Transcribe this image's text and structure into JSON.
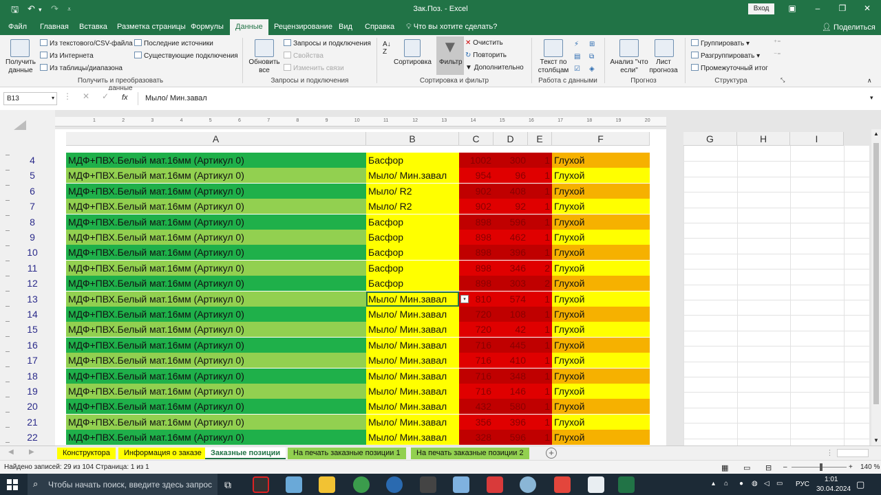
{
  "titlebar": {
    "title": "Зак.Поз. - Excel",
    "signin_label": "Вход",
    "save_icon": "save-icon",
    "undo_icon": "undo-icon",
    "redo_icon": "redo-icon",
    "customize_icon": "customize-icon"
  },
  "tabs": {
    "items": [
      "Файл",
      "Главная",
      "Вставка",
      "Разметка страницы",
      "Формулы",
      "Данные",
      "Рецензирование",
      "Вид",
      "Справка"
    ],
    "active": "Данные",
    "tellme": "Что вы хотите сделать?",
    "share": "Поделиться"
  },
  "ribbon": {
    "get_data": "Получить данные",
    "from_text": "Из текстового/CSV-файла",
    "from_web": "Из Интернета",
    "from_table": "Из таблицы/диапазона",
    "recent_sources": "Последние источники",
    "existing_connections": "Существующие подключения",
    "group_get": "Получить и преобразовать данные",
    "refresh_all": "Обновить все",
    "queries_connections": "Запросы и подключения",
    "properties": "Свойства",
    "edit_links": "Изменить связи",
    "group_queries": "Запросы и подключения",
    "sort_az_icon": "sort-az-icon",
    "sort": "Сортировка",
    "filter": "Фильтр",
    "clear": "Очистить",
    "reapply": "Повторить",
    "advanced": "Дополнительно",
    "group_sort": "Сортировка и фильтр",
    "text_to_columns": "Текст по столбцам",
    "group_data_tools": "Работа с данными",
    "what_if": "Анализ \"что если\"",
    "forecast_sheet": "Лист прогноза",
    "group_forecast": "Прогноз",
    "group": "Группировать",
    "ungroup": "Разгруппировать",
    "subtotal": "Промежуточный итог",
    "group_outline": "Структура"
  },
  "formula_bar": {
    "name_box": "B13",
    "fx": "fx",
    "formula": "Мыло/ Мин.завал"
  },
  "columns": [
    "A",
    "B",
    "C",
    "D",
    "E",
    "F",
    "G",
    "H",
    "I"
  ],
  "ruler_ticks": [
    "1",
    "2",
    "3",
    "4",
    "5",
    "6",
    "7",
    "8",
    "9",
    "10",
    "11",
    "12",
    "13",
    "14",
    "15",
    "16",
    "17",
    "18",
    "19",
    "20"
  ],
  "rows": [
    {
      "num": "4",
      "a": "МДФ+ПВХ.Белый мат.16мм (Артикул 0)",
      "b": "Басфор",
      "c": "1002",
      "d": "300",
      "e": "1",
      "f": "Глухой"
    },
    {
      "num": "5",
      "a": "МДФ+ПВХ.Белый мат.16мм (Артикул 0)",
      "b": "Мыло/ Мин.завал",
      "c": "954",
      "d": "96",
      "e": "1",
      "f": "Глухой"
    },
    {
      "num": "6",
      "a": "МДФ+ПВХ.Белый мат.16мм (Артикул 0)",
      "b": "Мыло/ R2",
      "c": "902",
      "d": "408",
      "e": "1",
      "f": "Глухой"
    },
    {
      "num": "7",
      "a": "МДФ+ПВХ.Белый мат.16мм (Артикул 0)",
      "b": "Мыло/ R2",
      "c": "902",
      "d": "92",
      "e": "1",
      "f": "Глухой"
    },
    {
      "num": "8",
      "a": "МДФ+ПВХ.Белый мат.16мм (Артикул 0)",
      "b": "Басфор",
      "c": "898",
      "d": "596",
      "e": "1",
      "f": "Глухой"
    },
    {
      "num": "9",
      "a": "МДФ+ПВХ.Белый мат.16мм (Артикул 0)",
      "b": "Басфор",
      "c": "898",
      "d": "462",
      "e": "1",
      "f": "Глухой"
    },
    {
      "num": "10",
      "a": "МДФ+ПВХ.Белый мат.16мм (Артикул 0)",
      "b": "Басфор",
      "c": "898",
      "d": "396",
      "e": "1",
      "f": "Глухой"
    },
    {
      "num": "11",
      "a": "МДФ+ПВХ.Белый мат.16мм (Артикул 0)",
      "b": "Басфор",
      "c": "898",
      "d": "346",
      "e": "2",
      "f": "Глухой"
    },
    {
      "num": "12",
      "a": "МДФ+ПВХ.Белый мат.16мм (Артикул 0)",
      "b": "Басфор",
      "c": "898",
      "d": "303",
      "e": "2",
      "f": "Глухой"
    },
    {
      "num": "13",
      "a": "МДФ+ПВХ.Белый мат.16мм (Артикул 0)",
      "b": "Мыло/ Мин.завал",
      "c": "810",
      "d": "574",
      "e": "1",
      "f": "Глухой"
    },
    {
      "num": "14",
      "a": "МДФ+ПВХ.Белый мат.16мм (Артикул 0)",
      "b": "Мыло/ Мин.завал",
      "c": "720",
      "d": "108",
      "e": "1",
      "f": "Глухой"
    },
    {
      "num": "15",
      "a": "МДФ+ПВХ.Белый мат.16мм (Артикул 0)",
      "b": "Мыло/ Мин.завал",
      "c": "720",
      "d": "42",
      "e": "1",
      "f": "Глухой"
    },
    {
      "num": "16",
      "a": "МДФ+ПВХ.Белый мат.16мм (Артикул 0)",
      "b": "Мыло/ Мин.завал",
      "c": "716",
      "d": "445",
      "e": "1",
      "f": "Глухой"
    },
    {
      "num": "17",
      "a": "МДФ+ПВХ.Белый мат.16мм (Артикул 0)",
      "b": "Мыло/ Мин.завал",
      "c": "716",
      "d": "410",
      "e": "1",
      "f": "Глухой"
    },
    {
      "num": "18",
      "a": "МДФ+ПВХ.Белый мат.16мм (Артикул 0)",
      "b": "Мыло/ Мин.завал",
      "c": "716",
      "d": "348",
      "e": "1",
      "f": "Глухой"
    },
    {
      "num": "19",
      "a": "МДФ+ПВХ.Белый мат.16мм (Артикул 0)",
      "b": "Мыло/ Мин.завал",
      "c": "716",
      "d": "146",
      "e": "1",
      "f": "Глухой"
    },
    {
      "num": "20",
      "a": "МДФ+ПВХ.Белый мат.16мм (Артикул 0)",
      "b": "Мыло/ Мин.завал",
      "c": "432",
      "d": "580",
      "e": "1",
      "f": "Глухой"
    },
    {
      "num": "21",
      "a": "МДФ+ПВХ.Белый мат.16мм (Артикул 0)",
      "b": "Мыло/ Мин.завал",
      "c": "356",
      "d": "396",
      "e": "1",
      "f": "Глухой"
    },
    {
      "num": "22",
      "a": "МДФ+ПВХ.Белый мат.16мм (Артикул 0)",
      "b": "Мыло/ Мин.завал",
      "c": "328",
      "d": "596",
      "e": "1",
      "f": "Глухой"
    }
  ],
  "colors": {
    "green_dark": "#1fb04a",
    "green_light": "#92d050",
    "yellow": "#ffff00",
    "red_dark": "#c00000",
    "red_mid": "#e00000",
    "orange": "#f6b100",
    "excel_green": "#217346"
  },
  "sheet_tabs": [
    {
      "label": "Конструктора",
      "color": "#ffff00"
    },
    {
      "label": "Информация о заказе",
      "color": "#ffff00"
    },
    {
      "label": "Заказные позиции",
      "color": "#ffffff"
    },
    {
      "label": "На печать заказные позиции  1",
      "color": "#92d050"
    },
    {
      "label": "На печать заказные позиции 2",
      "color": "#92d050"
    }
  ],
  "active_sheet": "Заказные позиции",
  "status": {
    "records": "Найдено записей: 29 из 104",
    "page": "Страница: 1 из 1",
    "zoom": "140 %"
  },
  "taskbar": {
    "search_placeholder": "Чтобы начать поиск, введите здесь запрос",
    "lang": "РУС",
    "time": "1:01",
    "date": "30.04.2024"
  }
}
